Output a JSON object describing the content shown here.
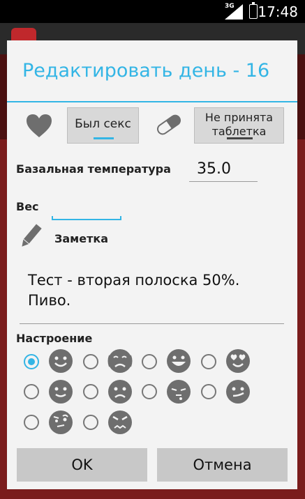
{
  "status_bar": {
    "time": "17:48",
    "network": "3G"
  },
  "dialog": {
    "title": "Редактировать день - 16",
    "sex_button": "Был секс",
    "pill_button_line1": "Не принята",
    "pill_button_line2": "таблетка",
    "temperature_label": "Базальная температура",
    "temperature_value": "35.0",
    "weight_label": "Вес",
    "weight_value": "",
    "note_label": "Заметка",
    "note_text": "Тест - вторая полоска 50%. Пиво.",
    "mood_label": "Настроение",
    "moods": [
      {
        "icon": "happy-face-icon",
        "selected": true
      },
      {
        "icon": "crying-face-icon",
        "selected": false
      },
      {
        "icon": "grinning-face-icon",
        "selected": false
      },
      {
        "icon": "heart-eyes-face-icon",
        "selected": false
      },
      {
        "icon": "smiling-face-icon",
        "selected": false
      },
      {
        "icon": "sad-face-icon",
        "selected": false
      },
      {
        "icon": "sleepy-face-icon",
        "selected": false
      },
      {
        "icon": "smirking-face-icon",
        "selected": false
      },
      {
        "icon": "skeptical-face-icon",
        "selected": false
      },
      {
        "icon": "angry-face-icon",
        "selected": false
      }
    ],
    "ok_label": "OK",
    "cancel_label": "Отмена"
  },
  "colors": {
    "accent": "#33b5e5",
    "face": "#6e6e6e",
    "button": "#c8c8c8"
  }
}
